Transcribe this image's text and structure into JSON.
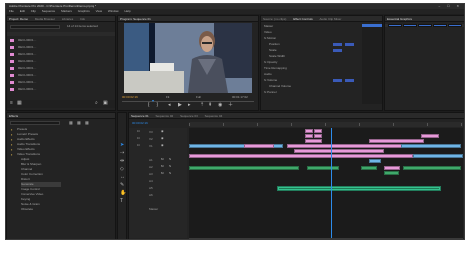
{
  "window": {
    "title": "Adobe Premiere Pro 2020 - C:\\Premiere Pro\\Demo\\Demo.prproj *",
    "controls": "–  ☐  ✕"
  },
  "menu": [
    "File",
    "Edit",
    "Clip",
    "Sequence",
    "Markers",
    "Graphics",
    "View",
    "Window",
    "Help"
  ],
  "project": {
    "tabs": [
      "Project: Demo",
      "Media Browser",
      "Libraries",
      "Info"
    ],
    "search_placeholder": "",
    "items_count": "14 of 14 items selected",
    "item_label": "RECLI0001…"
  },
  "program": {
    "tab": "Program: Sequence 01",
    "timecode_left": "00:00:02:16",
    "fit": "Fit",
    "scale": "Full",
    "timecode_right": "00:01:17:02"
  },
  "effects": {
    "tabs": [
      "Source: (no clips)",
      "Effect Controls",
      "Audio Clip Mixer",
      "Metadata"
    ],
    "rows": [
      "Master",
      "Video",
      "fx Motion",
      "Position",
      "Scale",
      "Scale Width",
      "fx Opacity",
      "Time Remapping",
      "Audio",
      "fx Volume",
      "Channel Volume",
      "fx Panner"
    ]
  },
  "media": {
    "tabs": [
      "Effects"
    ],
    "folders": [
      "Presets",
      "Lumetri Presets",
      "Audio Effects",
      "Audio Transitions",
      "Video Effects",
      "Video Transitions",
      "Adjust",
      "Blur & Sharpen",
      "Channel",
      "Color Correction",
      "Distort",
      "Generate",
      "Image Control",
      "Immersive Video",
      "Keying",
      "Noise & Grain",
      "Obsolete"
    ]
  },
  "timeline": {
    "tabs": [
      "Sequence 01",
      "Sequence 02",
      "Sequence 03",
      "Sequence 04"
    ],
    "timecode": "00:00:02:16",
    "tracks": [
      "V3",
      "V2",
      "V1",
      "A1",
      "A2",
      "A3",
      "A4",
      "A5",
      "A6",
      "Master"
    ]
  },
  "colors": {
    "accent": "#2d8ceb",
    "clip_pink": "#e79ad9",
    "clip_blue": "#6fb5e6",
    "clip_green": "#3fa96b",
    "clip_teal": "#35c18e",
    "clip_rose": "#e05a86"
  }
}
